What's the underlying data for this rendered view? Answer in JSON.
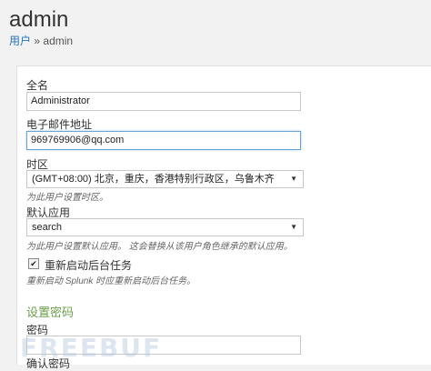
{
  "header": {
    "title": "admin",
    "breadcrumb_parent": "用户",
    "breadcrumb_separator": "»",
    "breadcrumb_current": "admin"
  },
  "form": {
    "full_name_label": "全名",
    "full_name_value": "Administrator",
    "email_label": "电子邮件地址",
    "email_value": "969769906@qq.com",
    "timezone_label": "时区",
    "timezone_value": "(GMT+08:00) 北京，重庆，香港特别行政区，乌鲁木齐",
    "timezone_help": "为此用户设置时区。",
    "default_app_label": "默认应用",
    "default_app_value": "search",
    "default_app_help": "为此用户设置默认应用。 这会替换从该用户角色继承的默认应用。",
    "restart_tasks_label": "重新启动后台任务",
    "restart_tasks_checked": true,
    "restart_tasks_help": "重新启动 Splunk 时应重新启动后台任务。",
    "password_section_title": "设置密码",
    "password_label": "密码",
    "password_value": "",
    "confirm_password_label": "确认密码"
  },
  "watermark": {
    "text": "FREEBUF"
  },
  "colors": {
    "link": "#2a72b8",
    "section_title": "#6aa04a",
    "focus_border": "#6aa3d8"
  }
}
